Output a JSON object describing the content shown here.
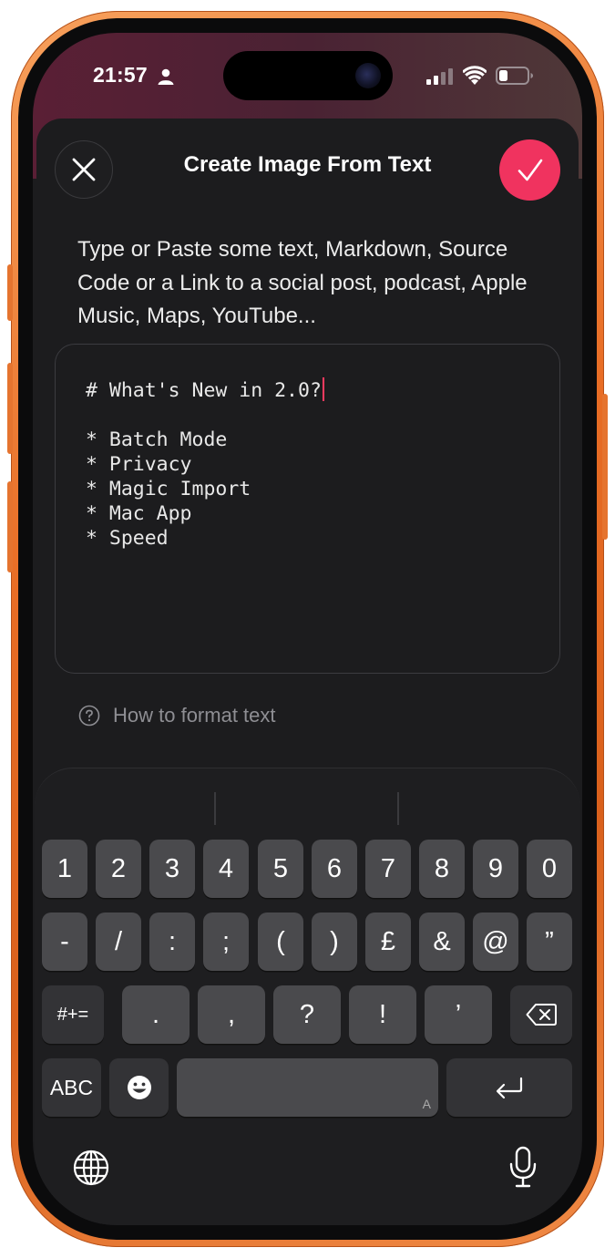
{
  "status_bar": {
    "time": "21:57",
    "icons": [
      "person-icon",
      "signal-icon",
      "wifi-icon",
      "battery-icon"
    ]
  },
  "header": {
    "title": "Create Image From Text",
    "close_icon": "close-icon",
    "done_icon": "checkmark-icon"
  },
  "description": "Type or Paste some text, Markdown, Source Code or a Link to a social post, podcast, Apple Music, Maps, YouTube...",
  "editor": {
    "lines": [
      "# What's New in 2.0?",
      "",
      "* Batch Mode",
      "* Privacy",
      "* Magic Import",
      "* Mac App",
      "* Speed"
    ]
  },
  "help_link": "How to format text",
  "keyboard": {
    "row1": [
      "1",
      "2",
      "3",
      "4",
      "5",
      "6",
      "7",
      "8",
      "9",
      "0"
    ],
    "row2": [
      "-",
      "/",
      ":",
      ";",
      "(",
      ")",
      "£",
      "&",
      "@",
      "”"
    ],
    "row3": [
      "#+=",
      ".",
      ",",
      "?",
      "!",
      "’"
    ],
    "row4": {
      "abc": "ABC",
      "space_hint": "A"
    },
    "icons": [
      "delete-icon",
      "emoji-icon",
      "return-icon",
      "globe-icon",
      "microphone-icon"
    ]
  },
  "colors": {
    "accent": "#f0335f",
    "caret": "#ff3a5f",
    "frame": "#e86d25"
  }
}
